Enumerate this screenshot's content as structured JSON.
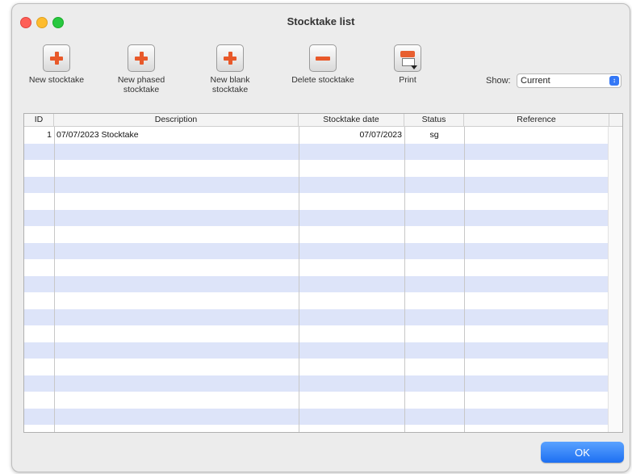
{
  "window": {
    "title": "Stocktake list"
  },
  "toolbar": {
    "new_stocktake": [
      "New stocktake"
    ],
    "new_phased": [
      "New phased",
      "stocktake"
    ],
    "new_blank": [
      "New blank",
      "stocktake"
    ],
    "delete": [
      "Delete stocktake"
    ],
    "print": [
      "Print"
    ]
  },
  "show": {
    "label": "Show:",
    "value": "Current"
  },
  "table": {
    "headers": {
      "id": "ID",
      "description": "Description",
      "date": "Stocktake date",
      "status": "Status",
      "reference": "Reference"
    },
    "rows": [
      {
        "id": "1",
        "description": "07/07/2023 Stocktake",
        "date": "07/07/2023",
        "status": "sg",
        "reference": ""
      }
    ]
  },
  "ok_label": "OK",
  "colors": {
    "accent": "#1d6ff2",
    "row_alt": "#dde4f9",
    "icon_orange": "#e8592a"
  }
}
